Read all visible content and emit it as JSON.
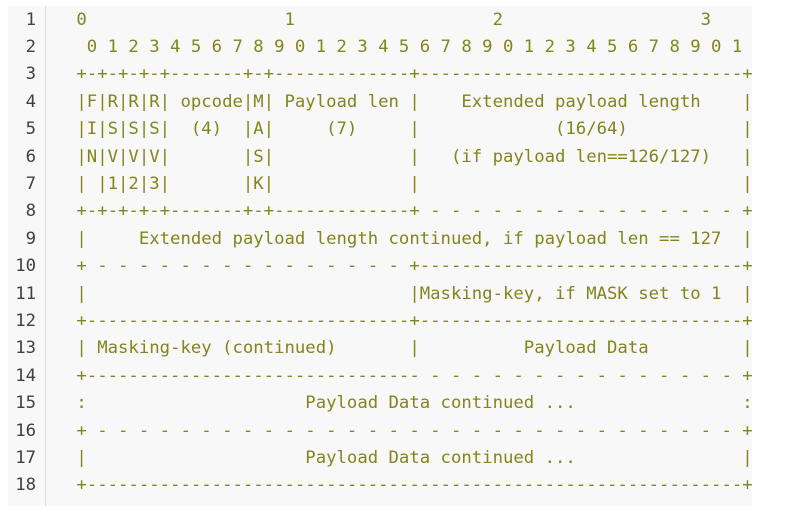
{
  "colors": {
    "code_text": "#83841c",
    "line_number": "#404040",
    "background": "#f8f8f8",
    "gutter_border": "#dcdcdc"
  },
  "lines": [
    {
      "num": "1",
      "text": " 0                   1                   2                   3"
    },
    {
      "num": "2",
      "text": "  0 1 2 3 4 5 6 7 8 9 0 1 2 3 4 5 6 7 8 9 0 1 2 3 4 5 6 7 8 9 0 1"
    },
    {
      "num": "3",
      "text": " +-+-+-+-+-------+-+-------------+-------------------------------+"
    },
    {
      "num": "4",
      "text": " |F|R|R|R| opcode|M| Payload len |    Extended payload length    |"
    },
    {
      "num": "5",
      "text": " |I|S|S|S|  (4)  |A|     (7)     |             (16/64)           |"
    },
    {
      "num": "6",
      "text": " |N|V|V|V|       |S|             |   (if payload len==126/127)   |"
    },
    {
      "num": "7",
      "text": " | |1|2|3|       |K|             |                               |"
    },
    {
      "num": "8",
      "text": " +-+-+-+-+-------+-+-------------+ - - - - - - - - - - - - - - - +"
    },
    {
      "num": "9",
      "text": " |     Extended payload length continued, if payload len == 127  |"
    },
    {
      "num": "10",
      "text": " + - - - - - - - - - - - - - - - +-------------------------------+"
    },
    {
      "num": "11",
      "text": " |                               |Masking-key, if MASK set to 1  |"
    },
    {
      "num": "12",
      "text": " +-------------------------------+-------------------------------+"
    },
    {
      "num": "13",
      "text": " | Masking-key (continued)       |          Payload Data         |"
    },
    {
      "num": "14",
      "text": " +-------------------------------- - - - - - - - - - - - - - - - +"
    },
    {
      "num": "15",
      "text": " :                     Payload Data continued ...                :"
    },
    {
      "num": "16",
      "text": " + - - - - - - - - - - - - - - - - - - - - - - - - - - - - - - - +"
    },
    {
      "num": "17",
      "text": " |                     Payload Data continued ...                |"
    },
    {
      "num": "18",
      "text": " +---------------------------------------------------------------+"
    }
  ]
}
